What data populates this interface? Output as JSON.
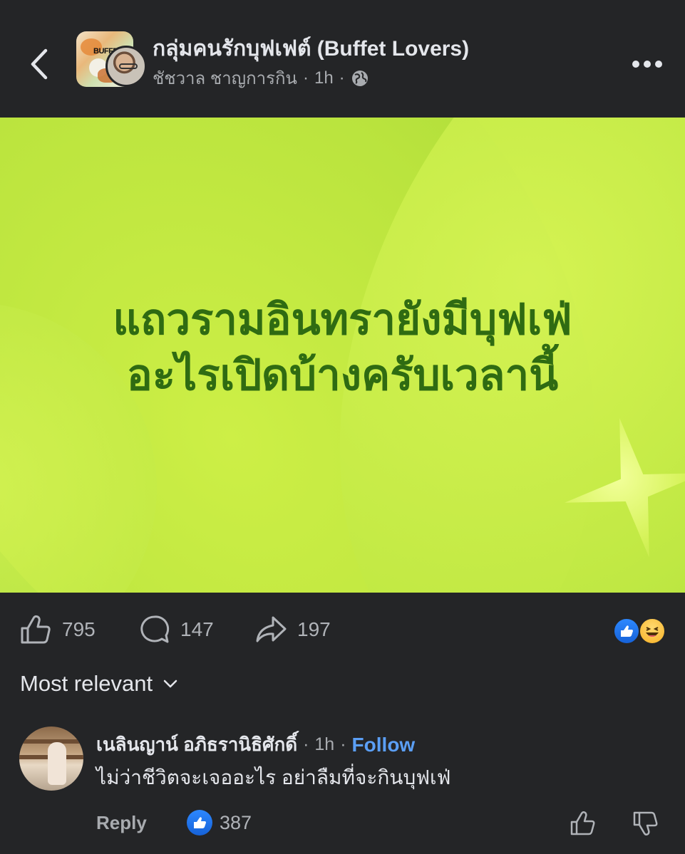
{
  "header": {
    "group_name": "กลุ่มคนรักบุฟเฟต์ (Buffet Lovers)",
    "author": "ชัชวาล ชาญการกิน",
    "time": "1h",
    "separator": "·",
    "avatar_text": "BUFFET"
  },
  "post": {
    "text_line1": "แถวรามอินทรายังมีบุฟเฟ่",
    "text_line2": "อะไรเปิดบ้างครับเวลานี้"
  },
  "actions": {
    "likes": "795",
    "comments": "147",
    "shares": "197"
  },
  "sort": {
    "label": "Most relevant"
  },
  "comment": {
    "name": "เนลินญาน์ อภิธรานิธิศักดิ์",
    "time": "1h",
    "separator": "·",
    "follow_label": "Follow",
    "text": "ไม่ว่าชีวิตจะเจออะไร อย่าลืมที่จะกินบุฟเฟ่",
    "reply_label": "Reply",
    "likes": "387"
  },
  "colors": {
    "background": "#242527",
    "accent_blue": "#5b9ff5",
    "post_text": "#2f6b12"
  }
}
